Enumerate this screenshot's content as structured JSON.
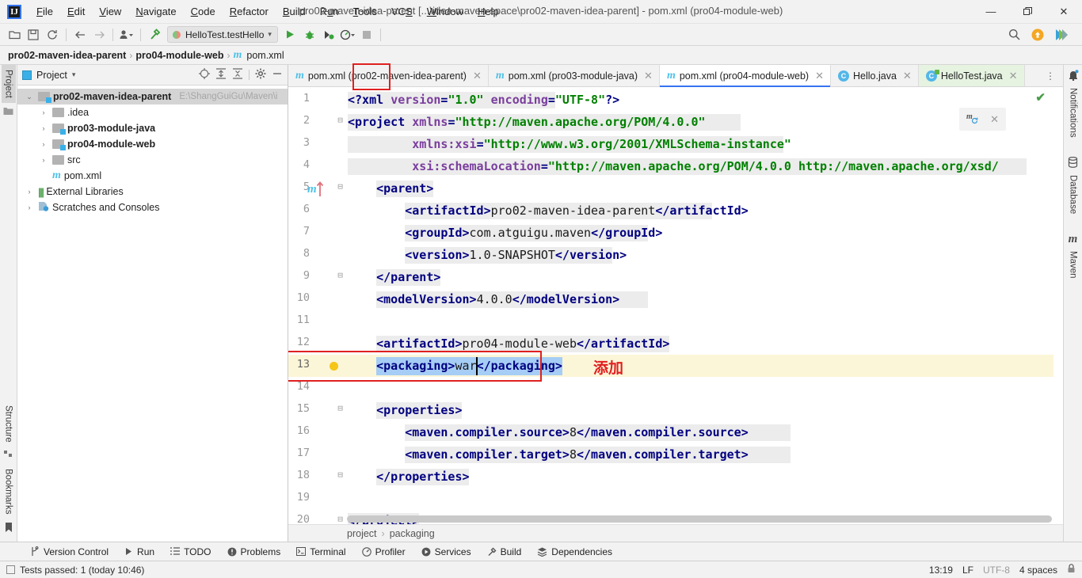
{
  "window": {
    "title": "pro02-maven-idea-parent [...\\idea-maven-space\\pro02-maven-idea-parent] - pom.xml (pro04-module-web)",
    "logo": "IJ",
    "minimize": "—",
    "maximize": "❐",
    "close": "✕"
  },
  "menubar": [
    {
      "label": "File",
      "mnemonic": "F"
    },
    {
      "label": "Edit",
      "mnemonic": "E"
    },
    {
      "label": "View",
      "mnemonic": "V"
    },
    {
      "label": "Navigate",
      "mnemonic": "N"
    },
    {
      "label": "Code",
      "mnemonic": "C"
    },
    {
      "label": "Refactor",
      "mnemonic": "R"
    },
    {
      "label": "Build",
      "mnemonic": "B"
    },
    {
      "label": "Run",
      "mnemonic": "u"
    },
    {
      "label": "Tools",
      "mnemonic": "T"
    },
    {
      "label": "VCS",
      "mnemonic": "S"
    },
    {
      "label": "Window",
      "mnemonic": "W"
    },
    {
      "label": "Help",
      "mnemonic": "H"
    }
  ],
  "toolbar": {
    "open_icon": "open-folder-icon",
    "save_icon": "save-icon",
    "sync_icon": "sync-icon",
    "back_icon": "back-arrow-icon",
    "forward_icon": "forward-arrow-icon",
    "profile_icon": "user-profile-icon",
    "build_icon": "hammer-icon",
    "run_config": "HelloTest.testHello",
    "run_icon": "run-icon",
    "debug_icon": "debug-icon",
    "coverage_icon": "run-with-coverage-icon",
    "profiler_icon": "profiler-icon",
    "stop_icon": "stop-icon",
    "search_icon": "search-icon",
    "update_icon": "update-badge-icon",
    "ai_icon": "ide-services-icon"
  },
  "breadcrumb": {
    "items": [
      "pro02-maven-idea-parent",
      "pro04-module-web",
      "pom.xml"
    ],
    "separator": "›"
  },
  "left_strip": {
    "top": [
      {
        "label": "Project",
        "icon": "project-folder-icon",
        "active": true
      }
    ],
    "bottom": [
      {
        "label": "Structure",
        "icon": "structure-icon"
      },
      {
        "label": "Bookmarks",
        "icon": "bookmark-icon"
      }
    ]
  },
  "right_strip": [
    {
      "label": "Notifications",
      "icon": "bell-icon"
    },
    {
      "label": "Database",
      "icon": "database-icon"
    },
    {
      "label": "Maven",
      "icon": "maven-m-icon"
    }
  ],
  "project_panel": {
    "title": "Project",
    "dropdown_caret": "▾",
    "tools": [
      "locate-icon",
      "expand-all-icon",
      "collapse-all-icon",
      "settings-gear-icon",
      "hide-icon"
    ],
    "tree": [
      {
        "depth": 0,
        "arrow": "⌄",
        "icon": "module-folder-icon",
        "label": "pro02-maven-idea-parent",
        "bold": true,
        "selected": true,
        "path": "E:\\ShangGuiGu\\Maven\\i"
      },
      {
        "depth": 1,
        "arrow": "›",
        "icon": "folder-icon",
        "label": ".idea",
        "bold": false
      },
      {
        "depth": 1,
        "arrow": "›",
        "icon": "module-folder-icon",
        "label": "pro03-module-java",
        "bold": true
      },
      {
        "depth": 1,
        "arrow": "›",
        "icon": "module-folder-icon",
        "label": "pro04-module-web",
        "bold": true
      },
      {
        "depth": 1,
        "arrow": "›",
        "icon": "folder-icon",
        "label": "src",
        "bold": false
      },
      {
        "depth": 1,
        "arrow": "",
        "icon": "maven-file-icon",
        "label": "pom.xml",
        "bold": false
      },
      {
        "depth": 0,
        "arrow": "›",
        "icon": "library-icon",
        "label": "External Libraries",
        "bold": false
      },
      {
        "depth": 0,
        "arrow": "›",
        "icon": "scratches-icon",
        "label": "Scratches and Consoles",
        "bold": false
      }
    ]
  },
  "editor_tabs": [
    {
      "label": "pom.xml (pro02-maven-idea-parent)",
      "icon": "maven-file-icon",
      "active": false,
      "close": "✕"
    },
    {
      "label": "pom.xml (pro03-module-java)",
      "icon": "maven-file-icon",
      "active": false,
      "close": "✕"
    },
    {
      "label": "pom.xml (pro04-module-web)",
      "icon": "maven-file-icon",
      "active": true,
      "highlighted": true,
      "close": "✕"
    },
    {
      "label": "Hello.java",
      "icon": "java-class-icon",
      "active": false,
      "close": "✕"
    },
    {
      "label": "HelloTest.java",
      "icon": "java-test-class-icon",
      "active": false,
      "green": true,
      "close": "✕"
    }
  ],
  "tab_overflow": "⋮",
  "editor": {
    "gutter_marker_line": 5,
    "gutter_marker_icon": "maven-parent-arrow-icon",
    "bulb_icon": "intention-bulb-icon",
    "inspection_ok_icon": "✔",
    "caret_position": "13:19",
    "annotation_text": "添加",
    "selected_text": "<packaging>war</packaging>",
    "maven_popup": {
      "icon": "maven-reload-icon",
      "close": "✕"
    },
    "lines": [
      {
        "n": 1,
        "fold": "",
        "indent": 0,
        "tokens": [
          {
            "t": "pi",
            "v": "<?xml "
          },
          {
            "t": "attr",
            "v": "version"
          },
          {
            "t": "pi",
            "v": "="
          },
          {
            "t": "str",
            "v": "\"1.0\""
          },
          {
            "t": "pi",
            "v": " "
          },
          {
            "t": "attr",
            "v": "encoding"
          },
          {
            "t": "pi",
            "v": "="
          },
          {
            "t": "str",
            "v": "\"UTF-8\""
          },
          {
            "t": "pi",
            "v": "?>"
          }
        ],
        "hl_end": 29
      },
      {
        "n": 2,
        "fold": "⊟",
        "indent": 0,
        "tokens": [
          {
            "t": "tag",
            "v": "<project "
          },
          {
            "t": "attr",
            "v": "xmlns"
          },
          {
            "t": "tag",
            "v": "="
          },
          {
            "t": "str",
            "v": "\"http://maven.apache.org/POM/4.0.0\""
          }
        ],
        "hl_end": 55
      },
      {
        "n": 3,
        "fold": "",
        "indent": 0,
        "tokens": [
          {
            "t": "tag",
            "v": "         "
          },
          {
            "t": "attr",
            "v": "xmlns:xsi"
          },
          {
            "t": "tag",
            "v": "="
          },
          {
            "t": "str",
            "v": "\"http://www.w3.org/2001/XMLSchema-instance\""
          }
        ],
        "hl_end": 61
      },
      {
        "n": 4,
        "fold": "",
        "indent": 0,
        "tokens": [
          {
            "t": "tag",
            "v": "         "
          },
          {
            "t": "attr",
            "v": "xsi:schemaLocation"
          },
          {
            "t": "tag",
            "v": "="
          },
          {
            "t": "str",
            "v": "\"http://maven.apache.org/POM/4.0.0 http://maven.apache.org/xsd/"
          }
        ],
        "hl_end": 95
      },
      {
        "n": 5,
        "fold": "⊟",
        "indent": 0,
        "tokens": [
          {
            "t": "tag",
            "v": "    <parent>"
          }
        ],
        "hl_start": 4,
        "hl_end": 12
      },
      {
        "n": 6,
        "fold": "",
        "indent": 0,
        "tokens": [
          {
            "t": "tag",
            "v": "        <artifactId>"
          },
          {
            "t": "txt",
            "v": "pro02-maven-idea-parent"
          },
          {
            "t": "tag",
            "v": "</artifactId>"
          }
        ],
        "hl_start": 8,
        "hl_end": 51
      },
      {
        "n": 7,
        "fold": "",
        "indent": 0,
        "tokens": [
          {
            "t": "tag",
            "v": "        <groupId>"
          },
          {
            "t": "txt",
            "v": "com.atguigu.maven"
          },
          {
            "t": "tag",
            "v": "</groupId>"
          }
        ],
        "hl_start": 8,
        "hl_end": 42
      },
      {
        "n": 8,
        "fold": "",
        "indent": 0,
        "tokens": [
          {
            "t": "tag",
            "v": "        <version>"
          },
          {
            "t": "txt",
            "v": "1.0-SNAPSHOT"
          },
          {
            "t": "tag",
            "v": "</version>"
          }
        ],
        "hl_start": 8,
        "hl_end": 37
      },
      {
        "n": 9,
        "fold": "⊟",
        "indent": 0,
        "tokens": [
          {
            "t": "tag",
            "v": "    </parent>"
          }
        ],
        "hl_start": 4,
        "hl_end": 13
      },
      {
        "n": 10,
        "fold": "",
        "indent": 0,
        "tokens": [
          {
            "t": "tag",
            "v": "    <modelVersion>"
          },
          {
            "t": "txt",
            "v": "4.0.0"
          },
          {
            "t": "tag",
            "v": "</modelVersion>"
          }
        ],
        "hl_start": 4,
        "hl_end": 42
      },
      {
        "n": 11,
        "fold": "",
        "indent": 0,
        "tokens": []
      },
      {
        "n": 12,
        "fold": "",
        "indent": 0,
        "tokens": [
          {
            "t": "tag",
            "v": "    <artifactId>"
          },
          {
            "t": "txt",
            "v": "pro04-module-web"
          },
          {
            "t": "tag",
            "v": "</artifactId>"
          }
        ],
        "hl_start": 4,
        "hl_end": 45
      },
      {
        "n": 13,
        "fold": "",
        "indent": 0,
        "current": true,
        "selected": true,
        "tokens": [
          {
            "t": "tag",
            "v": "    <packaging>"
          },
          {
            "t": "txt",
            "v": "war"
          },
          {
            "t": "tag",
            "v": "</packaging>"
          }
        ],
        "sel_start": 4,
        "sel_end": 30
      },
      {
        "n": 14,
        "fold": "",
        "indent": 0,
        "tokens": []
      },
      {
        "n": 15,
        "fold": "⊟",
        "indent": 0,
        "tokens": [
          {
            "t": "tag",
            "v": "    <properties>"
          }
        ],
        "hl_start": 4,
        "hl_end": 16
      },
      {
        "n": 16,
        "fold": "",
        "indent": 0,
        "tokens": [
          {
            "t": "tag",
            "v": "        <maven.compiler.source>"
          },
          {
            "t": "txt",
            "v": "8"
          },
          {
            "t": "tag",
            "v": "</maven.compiler.source>"
          }
        ],
        "hl_start": 8,
        "hl_end": 62
      },
      {
        "n": 17,
        "fold": "",
        "indent": 0,
        "tokens": [
          {
            "t": "tag",
            "v": "        <maven.compiler.target>"
          },
          {
            "t": "txt",
            "v": "8"
          },
          {
            "t": "tag",
            "v": "</maven.compiler.target>"
          }
        ],
        "hl_start": 8,
        "hl_end": 62
      },
      {
        "n": 18,
        "fold": "⊟",
        "indent": 0,
        "tokens": [
          {
            "t": "tag",
            "v": "    </properties>"
          }
        ],
        "hl_start": 4,
        "hl_end": 17
      },
      {
        "n": 19,
        "fold": "",
        "indent": 0,
        "tokens": []
      },
      {
        "n": 20,
        "fold": "⊟",
        "indent": 0,
        "tokens": [
          {
            "t": "tag",
            "v": "</project>"
          }
        ],
        "hl_start": 0,
        "hl_end": 10
      }
    ],
    "bottom_breadcrumb": [
      "project",
      "packaging"
    ],
    "bottom_breadcrumb_sep": "›"
  },
  "tool_window_bar": [
    {
      "label": "Version Control",
      "icon": "vcs-branch-icon"
    },
    {
      "label": "Run",
      "icon": "run-triangle-icon"
    },
    {
      "label": "TODO",
      "icon": "todo-list-icon"
    },
    {
      "label": "Problems",
      "icon": "problems-icon"
    },
    {
      "label": "Terminal",
      "icon": "terminal-icon"
    },
    {
      "label": "Profiler",
      "icon": "profiler-icon"
    },
    {
      "label": "Services",
      "icon": "services-icon"
    },
    {
      "label": "Build",
      "icon": "build-hammer-icon"
    },
    {
      "label": "Dependencies",
      "icon": "dependencies-icon"
    }
  ],
  "statusbar": {
    "message": "Tests passed: 1 (today 10:46)",
    "message_icon": "test-passed-icon",
    "caret": "13:19",
    "line_separator": "LF",
    "encoding": "UTF-8",
    "indent": "4 spaces",
    "lock_icon": "lock-icon"
  }
}
